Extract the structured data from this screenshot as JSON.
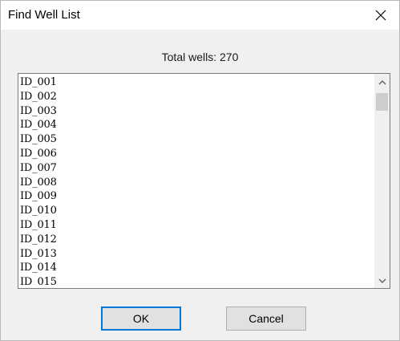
{
  "window": {
    "title": "Find Well List",
    "close_glyph": "close-icon"
  },
  "summary": {
    "total_label": "Total wells: 270"
  },
  "list": {
    "items": [
      "ID_001",
      "ID_002",
      "ID_003",
      "ID_004",
      "ID_005",
      "ID_006",
      "ID_007",
      "ID_008",
      "ID_009",
      "ID_010",
      "ID_011",
      "ID_012",
      "ID_013",
      "ID_014",
      "ID_015"
    ],
    "scrollbar": {
      "up_icon": "chevron-up-icon",
      "down_icon": "chevron-down-icon"
    }
  },
  "buttons": {
    "ok_label": "OK",
    "cancel_label": "Cancel"
  },
  "colors": {
    "focus_border": "#0078d7",
    "dialog_bg": "#f0f0f0",
    "titlebar_bg": "#ffffff"
  }
}
